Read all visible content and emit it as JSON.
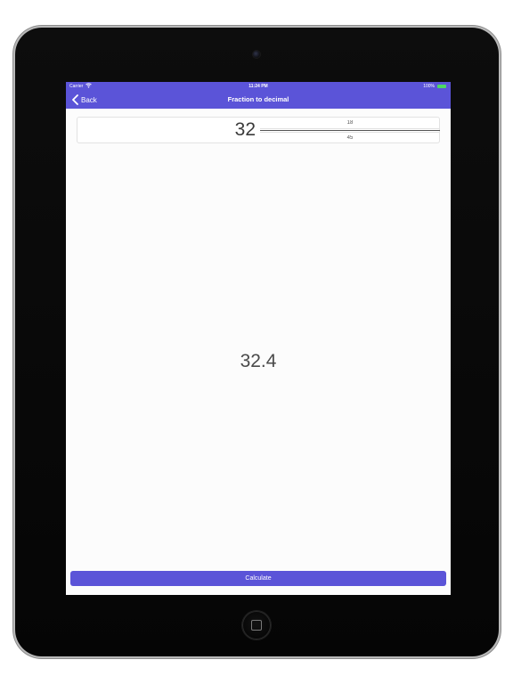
{
  "status_bar": {
    "carrier": "Carrier",
    "time": "11:24 PM",
    "battery": "100%"
  },
  "nav": {
    "back_label": "Back",
    "title": "Fraction to decimal"
  },
  "input": {
    "whole": "32",
    "numerator": "18",
    "denominator": "45"
  },
  "result": "32.4",
  "calculate_label": "Calculate",
  "colors": {
    "accent": "#5b54d8",
    "background": "#fcfcfc",
    "battery": "#4cd964"
  },
  "icons": [
    "back-chevron-icon",
    "wifi-icon",
    "battery-icon",
    "home-square-icon"
  ]
}
